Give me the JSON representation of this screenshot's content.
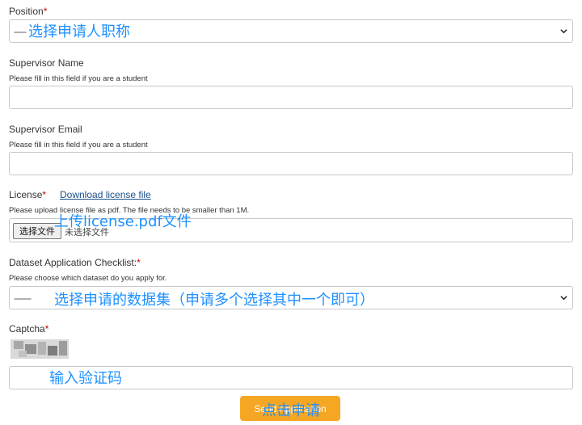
{
  "position": {
    "label": "Position",
    "required_mark": "*",
    "selected": "-----",
    "overlay": "选择申请人职称"
  },
  "supervisor_name": {
    "label": "Supervisor Name",
    "hint": "Please fill in this field if you are a student",
    "value": ""
  },
  "supervisor_email": {
    "label": "Supervisor Email",
    "hint": "Please fill in this field if you are a student",
    "value": ""
  },
  "license": {
    "label": "License",
    "required_mark": "*",
    "link": "Download license file",
    "hint": "Please upload license file as pdf. The file needs to be smaller than 1M.",
    "choose_button": "选择文件",
    "file_status": "未选择文件",
    "overlay": "上传license.pdf文件"
  },
  "checklist": {
    "label": "Dataset Application Checklist:",
    "required_mark": "*",
    "hint": "Please choose which dataset do you apply for.",
    "selected": "-------",
    "overlay": "选择申请的数据集（申请多个选择其中一个即可）"
  },
  "captcha": {
    "label": "Captcha",
    "required_mark": "*",
    "value": "",
    "overlay": "输入验证码"
  },
  "submit": {
    "label": "Send Application",
    "overlay": "点击申请"
  }
}
